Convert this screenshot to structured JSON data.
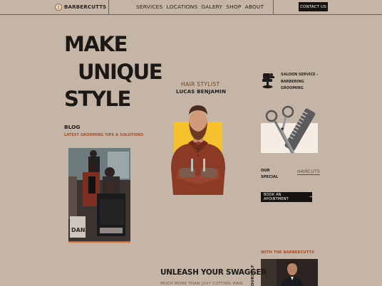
{
  "header": {
    "brand": "BARBERCUTTS",
    "nav": [
      "SERVICES",
      "LOCATIONS",
      "GALERY",
      "SHOP",
      "ABOUT"
    ],
    "contact_label": "CONTACT US"
  },
  "hero": {
    "line1": "MAKE",
    "line2": "UNIQUE",
    "line3": "STYLE"
  },
  "blog": {
    "title": "BLOG",
    "subtitle": "LATEST GROOMING TIPS & SOLUTIONS"
  },
  "stylist": {
    "role": "HAIR STYLIST",
    "name": "LUCAS BENJAMIN"
  },
  "services": {
    "line1": "SALOON SERVICE -",
    "line2": "BARBERING",
    "line3": "GROOMING"
  },
  "special": {
    "line1": "OUR",
    "line2": "SPECIAL",
    "link": "HAIRCUTS"
  },
  "booking": {
    "label": "BOOK AN APOINTMENT",
    "arrow": "→"
  },
  "team": {
    "title": "WITH THE BARBERCUTTS"
  },
  "section": {
    "vertical": "OURSELF",
    "title": "UNLEASH YOUR SWAGGER",
    "subtitle": "MUCH MORE THAN JUST CUTTING HAIR"
  },
  "colors": {
    "background": "#c4b5a6",
    "accent": "#f5c22e",
    "rust": "#a34d28",
    "dark": "#151210"
  }
}
